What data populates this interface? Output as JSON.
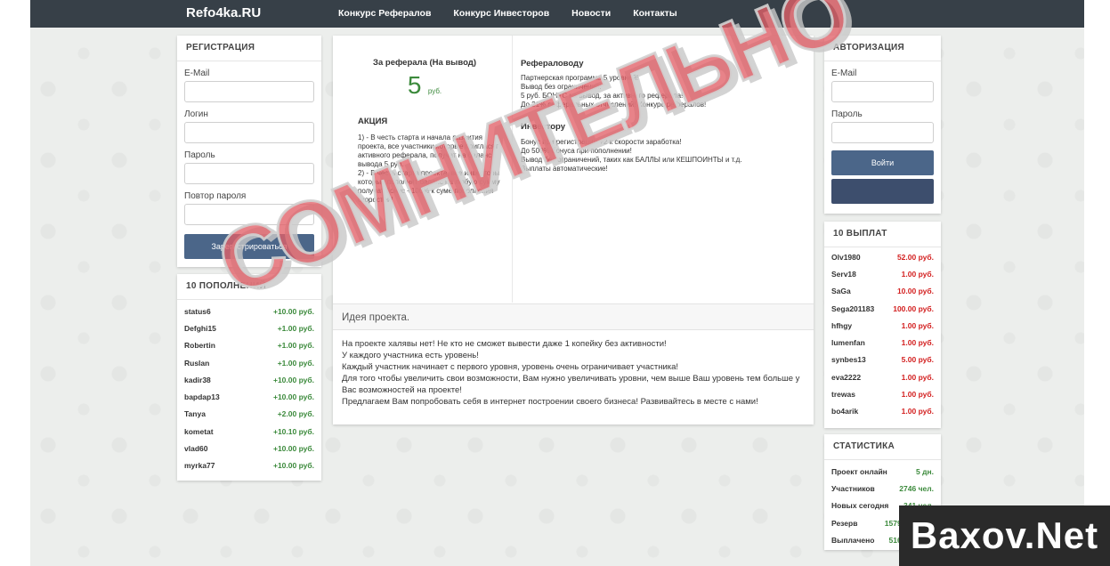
{
  "header": {
    "brand": "Refo4ka.RU",
    "nav": [
      "Конкурс Рефералов",
      "Конкурс Инвесторов",
      "Новости",
      "Контакты"
    ]
  },
  "registration": {
    "title": "РЕГИСТРАЦИЯ",
    "labels": [
      "E-Mail",
      "Логин",
      "Пароль",
      "Повтор пароля"
    ],
    "button": "Зарегистрироваться"
  },
  "deposits": {
    "title": "10 ПОПОЛНЕНИЙ",
    "rows": [
      {
        "name": "status6",
        "amount": "+10.00 руб."
      },
      {
        "name": "Defghi15",
        "amount": "+1.00 руб."
      },
      {
        "name": "Robertin",
        "amount": "+1.00 руб."
      },
      {
        "name": "Ruslan",
        "amount": "+1.00 руб."
      },
      {
        "name": "kadir38",
        "amount": "+10.00 руб."
      },
      {
        "name": "bapdap13",
        "amount": "+10.00 руб."
      },
      {
        "name": "Tanya",
        "amount": "+2.00 руб."
      },
      {
        "name": "kometat",
        "amount": "+10.10 руб."
      },
      {
        "name": "vlad60",
        "amount": "+10.00 руб."
      },
      {
        "name": "myrka77",
        "amount": "+10.00 руб."
      }
    ]
  },
  "center": {
    "referral_title": "За реферала (На вывод)",
    "referral_value": "5",
    "referral_unit": "руб.",
    "action_title": "АКЦИЯ",
    "action_text": "1) - В честь старта и начала развития проекта, все участники которые пригласят активного реферала, получат на баланс вывода 5 руб.\n2) - В честь старта проекта, все инвесторы которые пополнят баланс на любую сумму получат бонус +100% к суме пополнения скоростей!",
    "refs_title": "Рефераловоду",
    "refs_text": "Партнерская программа 5 уровней!\nВывод без ограничений!\n5 руб. БОНУС на вывод, за активного реферала!\nДо 21% реферальных отчислений! Конкурс рефералов!",
    "inv_title": "Инвестору",
    "inv_text": "Бонус при регистрации +2 к скорости заработка!\nДо 500% бонуса при пополнении!\nВывод без ограничений, таких как БАЛЛЫ или КЕШПОИНТЫ и т.д.\nВыплаты автоматические!",
    "idea_title": "Идея проекта.",
    "idea_text": "На проекте халявы нет! Не кто не сможет вывести даже 1 копейку без активности!\nУ каждого участника есть уровень!\nКаждый участник начинает с первого уровня, уровень очень ограничивает участника!\nДля того чтобы увеличить свои возможности, Вам нужно увеличивать уровни, чем выше Ваш уровень тем больше у Вас возможностей на проекте!\nПредлагаем Вам попробовать себя в интернет построении своего бизнеса! Развивайтесь в месте с нами!"
  },
  "auth": {
    "title": "АВТОРИЗАЦИЯ",
    "labels": [
      "E-Mail",
      "Пароль"
    ],
    "login_button": "Войти"
  },
  "payouts": {
    "title": "10 ВЫПЛАТ",
    "rows": [
      {
        "name": "Olv1980",
        "amount": "52.00 руб."
      },
      {
        "name": "Serv18",
        "amount": "1.00 руб."
      },
      {
        "name": "SaGa",
        "amount": "10.00 руб."
      },
      {
        "name": "Sega201183",
        "amount": "100.00 руб."
      },
      {
        "name": "hfhgy",
        "amount": "1.00 руб."
      },
      {
        "name": "lumenfan",
        "amount": "1.00 руб."
      },
      {
        "name": "synbes13",
        "amount": "5.00 руб."
      },
      {
        "name": "eva2222",
        "amount": "1.00 руб."
      },
      {
        "name": "trewas",
        "amount": "1.00 руб."
      },
      {
        "name": "bo4arik",
        "amount": "1.00 руб."
      }
    ]
  },
  "stats": {
    "title": "СТАТИСТИКА",
    "rows": [
      {
        "label": "Проект онлайн",
        "value": "5 дн."
      },
      {
        "label": "Участников",
        "value": "2746 чел."
      },
      {
        "label": "Новых сегодня",
        "value": "341 чел."
      },
      {
        "label": "Резерв",
        "value": "15793.74 руб."
      },
      {
        "label": "Выплачено",
        "value": "5164.00 руб."
      }
    ]
  },
  "overlay": {
    "stamp": "СОМНИТЕЛЬНО",
    "watermark": "Baxov.Net"
  },
  "colors": {
    "topbar": "#374048",
    "button": "#4b6689",
    "green": "#3c8a3c",
    "red": "#d31f1f",
    "stamp": "#e26068"
  }
}
